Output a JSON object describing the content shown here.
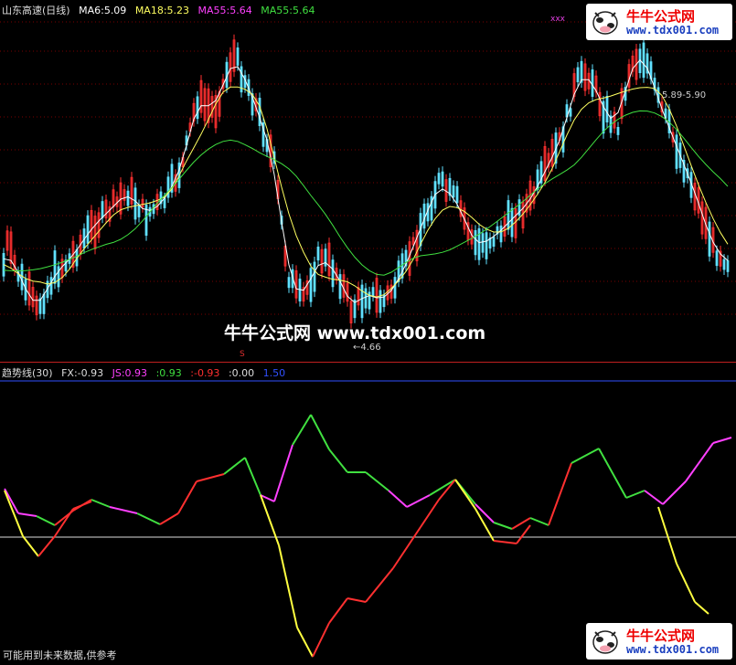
{
  "main": {
    "title": "山东高速(日线)",
    "ma": [
      {
        "label": "MA6:5.09",
        "color": "#ffffff"
      },
      {
        "label": "MA18:5.23",
        "color": "#ffff60"
      },
      {
        "label": "MA55:5.64",
        "color": "#ff40ff"
      },
      {
        "label": "MA55:5.64",
        "color": "#40e040"
      }
    ],
    "high_label": "5.89-5.90",
    "low_label": "←4.66",
    "marker": "xxx",
    "marker_s": "S"
  },
  "sub": {
    "title": "趋势线(30)",
    "values": [
      {
        "label": "FX:-0.93",
        "color": "#dddddd"
      },
      {
        "label": "JS:0.93",
        "color": "#ff40ff"
      },
      {
        "label": ":0.93",
        "color": "#40e040"
      },
      {
        "label": ":-0.93",
        "color": "#ff3030"
      },
      {
        "label": ":0.00",
        "color": "#dddddd"
      },
      {
        "label": "1.50",
        "color": "#3050ff"
      }
    ]
  },
  "watermark": "牛牛公式网 www.tdx001.com",
  "logo": {
    "title": "牛牛公式网",
    "url": "www.tdx001.com"
  },
  "footnote": "可能用到未来数据,供参考",
  "colors": {
    "up": "#ff3030",
    "down": "#60e0ff",
    "grid": "#7a0000",
    "ma6": "#ffffff",
    "ma18": "#ffff60",
    "ma55": "#40e040"
  }
}
